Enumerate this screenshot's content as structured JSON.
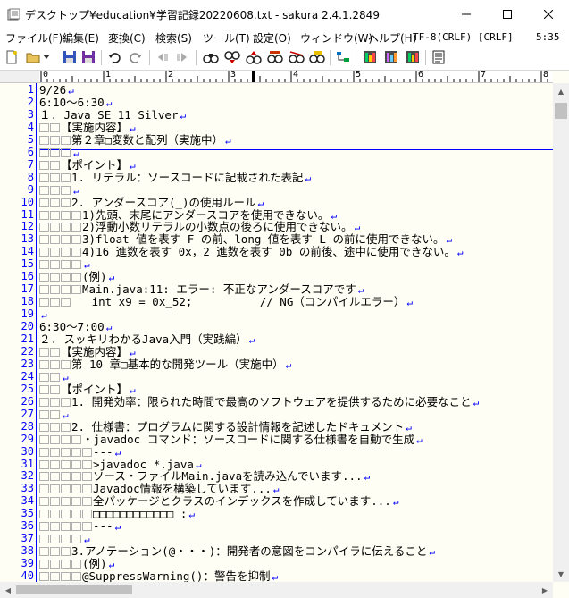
{
  "window": {
    "title": "デスクトップ¥education¥学習記録20220608.txt - sakura 2.4.1.2849"
  },
  "menu": {
    "items": [
      "ファイル(F)",
      "編集(E)",
      "変換(C)",
      "検索(S)",
      "ツール(T)",
      "設定(O)",
      "ウィンドウ(W)",
      "ヘルプ(H)"
    ],
    "encoding": "TF-8(CRLF) [CRLF]",
    "position": "5:35"
  },
  "ruler": {
    "marks": [
      "0",
      "1",
      "2",
      "3",
      "4",
      "5",
      "6",
      "7",
      "8"
    ]
  },
  "editor": {
    "line_numbers": [
      "1",
      "2",
      "3",
      "4",
      "5",
      "6",
      "7",
      "8",
      "9",
      "10",
      "11",
      "12",
      "13",
      "14",
      "15",
      "16",
      "17",
      "18",
      "19",
      "20",
      "21",
      "22",
      "23",
      "24",
      "25",
      "26",
      "27",
      "28",
      "29",
      "30",
      "31",
      "32",
      "33",
      "34",
      "35",
      "36",
      "37",
      "38",
      "39",
      "40"
    ],
    "lines": [
      {
        "indent": 0,
        "text": "9/26",
        "eol": true
      },
      {
        "indent": 0,
        "text": "6:10〜6:30",
        "eol": true
      },
      {
        "indent": 0,
        "text": "１. Java SE 11 Silver",
        "eol": true
      },
      {
        "indent": 2,
        "text": "【実施内容】",
        "eol": true
      },
      {
        "indent": 3,
        "text": "第２章□変数と配列（実施中）",
        "eol": true
      },
      {
        "indent": 3,
        "text": "",
        "eol": true
      },
      {
        "indent": 2,
        "text": "【ポイント】",
        "eol": true
      },
      {
        "indent": 3,
        "text": "1. リテラル：ソースコードに記載された表記",
        "eol": true
      },
      {
        "indent": 3,
        "text": "",
        "eol": true
      },
      {
        "indent": 3,
        "text": "2. アンダースコア(_)の使用ルール",
        "eol": true
      },
      {
        "indent": 4,
        "text": "1)先頭、末尾にアンダースコアを使用できない。",
        "eol": true
      },
      {
        "indent": 4,
        "text": "2)浮動小数リテラルの小数点の後ろに使用できない。",
        "eol": true
      },
      {
        "indent": 4,
        "text": "3)float 値を表す F の前、long 値を表す L の前に使用できない。",
        "eol": true
      },
      {
        "indent": 4,
        "text": "4)16 進数を表す 0x，2 進数を表す 0b の前後、途中に使用できない。",
        "eol": true
      },
      {
        "indent": 4,
        "text": "",
        "eol": true
      },
      {
        "indent": 4,
        "text": "(例)",
        "eol": true
      },
      {
        "indent": 4,
        "text": "Main.java:11: エラー: 不正なアンダースコアです",
        "eol": true
      },
      {
        "indent": 3,
        "text": "   int x9 = 0x_52;          // NG（コンパイルエラー）",
        "eol": true
      },
      {
        "indent": 0,
        "text": "",
        "eol": true
      },
      {
        "indent": 0,
        "text": "6:30〜7:00",
        "eol": true
      },
      {
        "indent": 0,
        "text": "２. スッキリわかるJava入門（実践編）",
        "eol": true
      },
      {
        "indent": 2,
        "text": "【実施内容】",
        "eol": true
      },
      {
        "indent": 3,
        "text": "第 10 章□基本的な開発ツール（実施中）",
        "eol": true
      },
      {
        "indent": 2,
        "text": "",
        "eol": true
      },
      {
        "indent": 2,
        "text": "【ポイント】",
        "eol": true
      },
      {
        "indent": 3,
        "text": "1. 開発効率：限られた時間で最高のソフトウェアを提供するために必要なこと",
        "eol": true
      },
      {
        "indent": 2,
        "text": "",
        "eol": true
      },
      {
        "indent": 3,
        "text": "2. 仕様書：プログラムに関する設計情報を記述したドキュメント",
        "eol": true
      },
      {
        "indent": 4,
        "text": "・javadoc コマンド：ソースコードに関する仕様書を自動で生成",
        "eol": true
      },
      {
        "indent": 5,
        "text": "---",
        "eol": true
      },
      {
        "indent": 5,
        "text": ">javadoc *.java",
        "eol": true
      },
      {
        "indent": 5,
        "text": "ソース・ファイルMain.javaを読み込んでいます...",
        "eol": true
      },
      {
        "indent": 5,
        "text": "Javadoc情報を構築しています...",
        "eol": true
      },
      {
        "indent": 5,
        "text": "全パッケージとクラスのインデックスを作成しています...",
        "eol": true
      },
      {
        "indent": 5,
        "text": "□□□□□□□□□□□□ :",
        "eol": true
      },
      {
        "indent": 5,
        "text": "---",
        "eol": true
      },
      {
        "indent": 4,
        "text": "",
        "eol": true
      },
      {
        "indent": 3,
        "text": "3.アノテーション(@・・・)：開発者の意図をコンパイラに伝えること",
        "eol": true
      },
      {
        "indent": 4,
        "text": "(例)",
        "eol": true
      },
      {
        "indent": 4,
        "text": "@SuppressWarning()：警告を抑制",
        "eol": true
      }
    ]
  },
  "colors": {
    "editor_bg": "#fffef4",
    "line_number": "#0000ff",
    "eol_mark": "#0000ff"
  }
}
